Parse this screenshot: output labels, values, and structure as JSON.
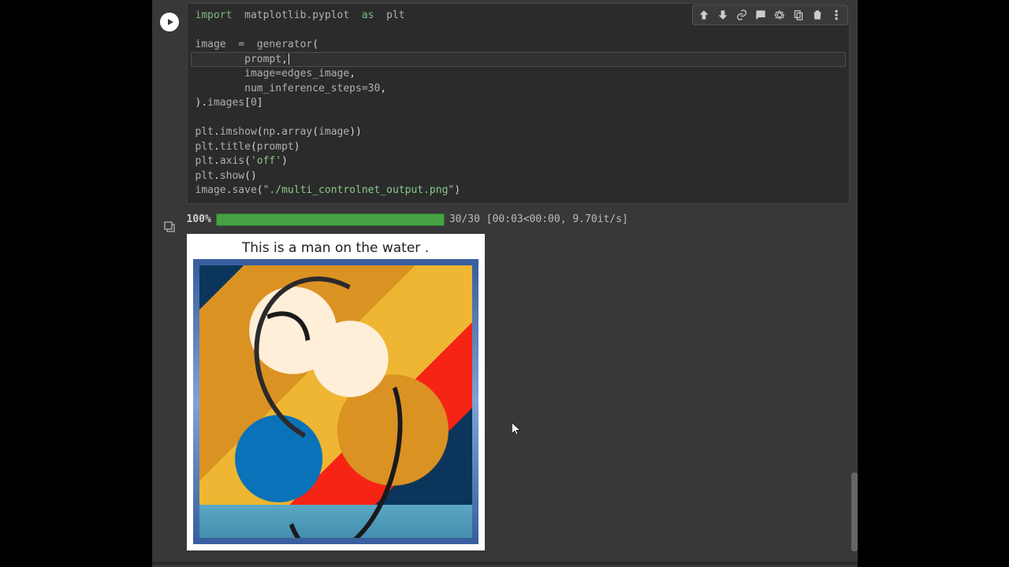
{
  "code": {
    "lines": [
      "import  matplotlib.pyplot  as  plt",
      "",
      "image  =  generator(",
      "        prompt,",
      "        image=edges_image,",
      "        num_inference_steps=30,",
      ").images[0]",
      "",
      "plt.imshow(np.array(image))",
      "plt.title(prompt)",
      "plt.axis('off')",
      "plt.show()",
      "image.save(\"./multi_controlnet_output.png\")"
    ],
    "cursor_line_index": 3
  },
  "toolbar": {
    "move_up": "Move cell up",
    "move_down": "Move cell down",
    "link": "Link to cell",
    "comment": "Add comment",
    "settings": "Cell settings",
    "mirror": "Mirror cell",
    "delete": "Delete cell",
    "more": "More actions"
  },
  "output": {
    "progress_pct": "100%",
    "progress_stats": "30/30 [00:03<00:00, 9.70it/s]",
    "figure_title": "This is a man on the water ."
  }
}
